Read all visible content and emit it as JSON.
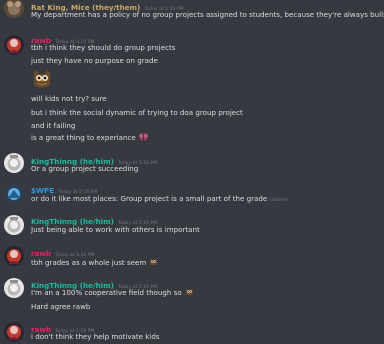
{
  "messages": [
    {
      "author": "Rat King, Mice (they/them)",
      "author_color": "#c9a86a",
      "timestamp": "Today at 5:15 PM",
      "avatar": "rat-king-avatar",
      "lines": [
        "My department has a policy of no group projects assigned to students, because they're always bullshit"
      ]
    },
    {
      "author": "rawb",
      "author_color": "#e91e63",
      "timestamp": "Today at 5:15 PM",
      "avatar": "rawb-avatar",
      "lines": [
        "tbh i think they should do group projects",
        "just they have no purpose on grade",
        "will kids not try? sure",
        "but i think the social dynamic of trying to doa  group project",
        "and it failing",
        "is a great thing to experiance"
      ]
    },
    {
      "author": "KingThinng (he/him)",
      "author_color": "#1abc9c",
      "timestamp": "Today at 5:16 PM",
      "avatar": "kingthinng-avatar",
      "lines": [
        "Or a group project succeeding"
      ]
    },
    {
      "author": "$WPE",
      "author_color": "#3498db",
      "timestamp": "Today at 5:16 PM",
      "avatar": "swpe-avatar",
      "lines": [
        "or do it like most places: Group project is a small part of the grade"
      ],
      "edited": "(edited)"
    },
    {
      "author": "KingThinng (he/him)",
      "author_color": "#1abc9c",
      "timestamp": "Today at 5:16 PM",
      "avatar": "kingthinng-avatar",
      "lines": [
        "Just being able to work with others is important"
      ]
    },
    {
      "author": "rawb",
      "author_color": "#e91e63",
      "timestamp": "Today at 5:16 PM",
      "avatar": "rawb-avatar",
      "lines": [
        "tbh grades as a whole just seem"
      ]
    },
    {
      "author": "KingThinng (he/him)",
      "author_color": "#1abc9c",
      "timestamp": "Today at 5:16 PM",
      "avatar": "kingthinng-avatar",
      "lines": [
        "I'm an a 100% cooperative field though so",
        "Hard agree rawb"
      ]
    },
    {
      "author": "rawb",
      "author_color": "#e91e63",
      "timestamp": "Today at 5:16 PM",
      "avatar": "rawb-avatar",
      "lines": [
        "i don't think they help motivate kids"
      ]
    }
  ]
}
